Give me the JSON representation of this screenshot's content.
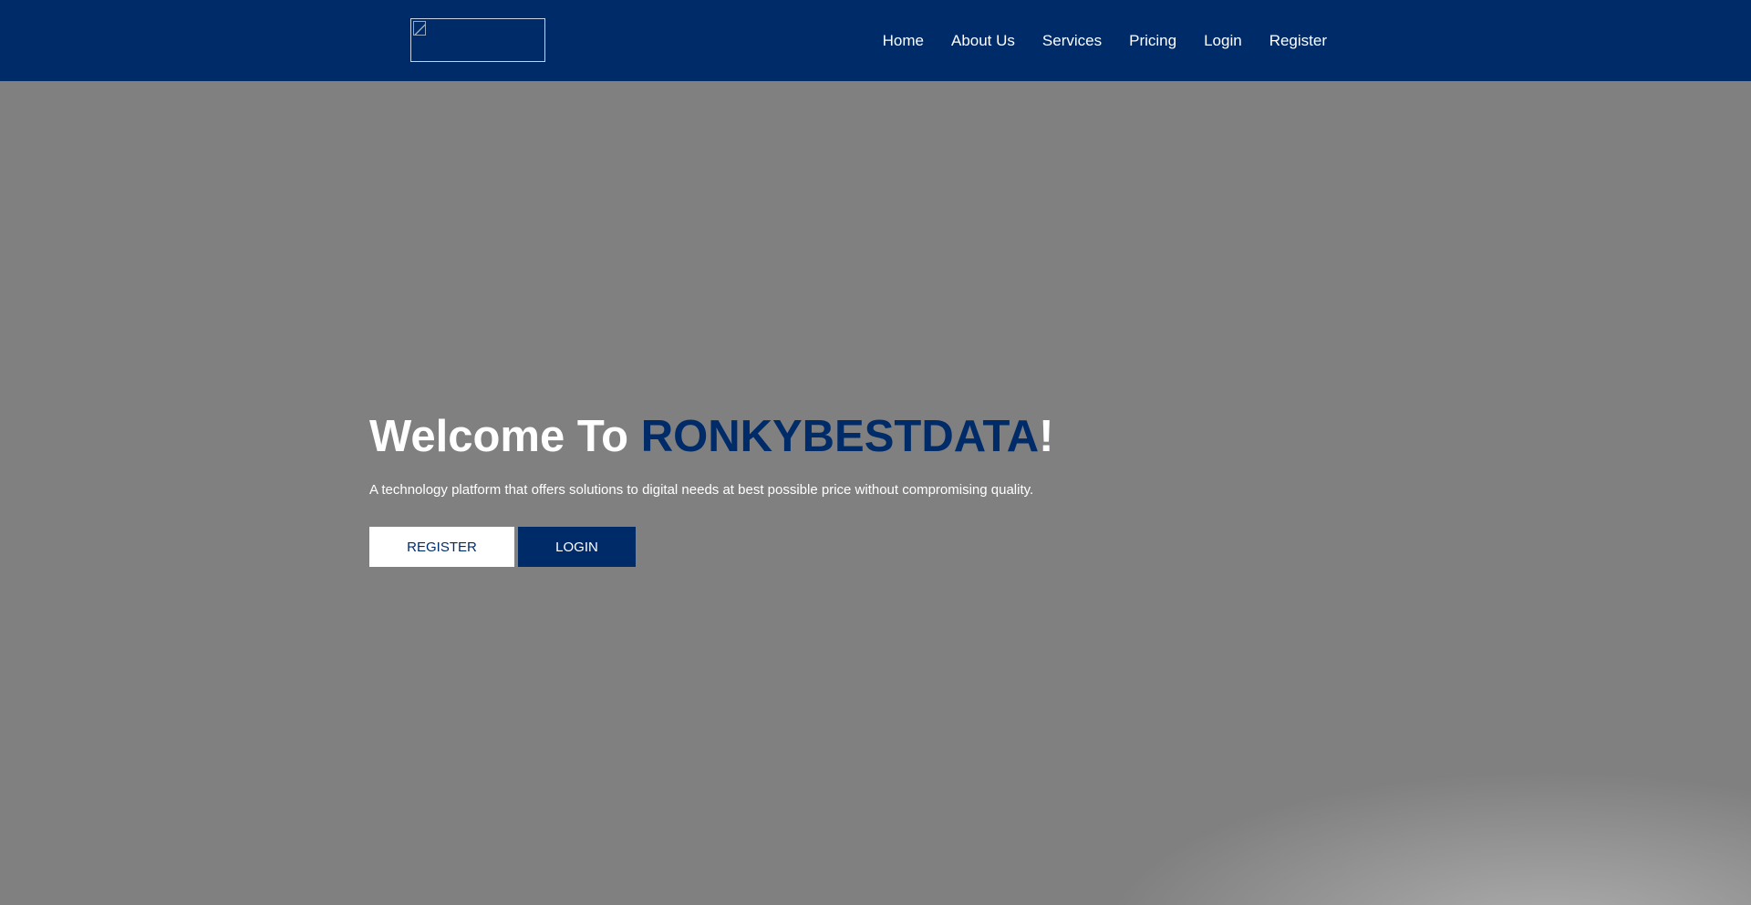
{
  "navbar": {
    "logo_alt": "",
    "links": [
      {
        "label": "Home"
      },
      {
        "label": "About Us"
      },
      {
        "label": "Services"
      },
      {
        "label": "Pricing"
      },
      {
        "label": "Login"
      },
      {
        "label": "Register"
      }
    ],
    "background_color": "#002b69"
  },
  "hero": {
    "title_prefix": "Welcome To ",
    "title_brand": "RONKYBESTDATA",
    "title_suffix": "!",
    "subtitle": "A technology platform that offers solutions to digital needs at best possible price without compromising quality.",
    "register_button": "REGISTER",
    "login_button": "LOGIN",
    "brand_color": "#002b69",
    "background_color": "#808080"
  }
}
